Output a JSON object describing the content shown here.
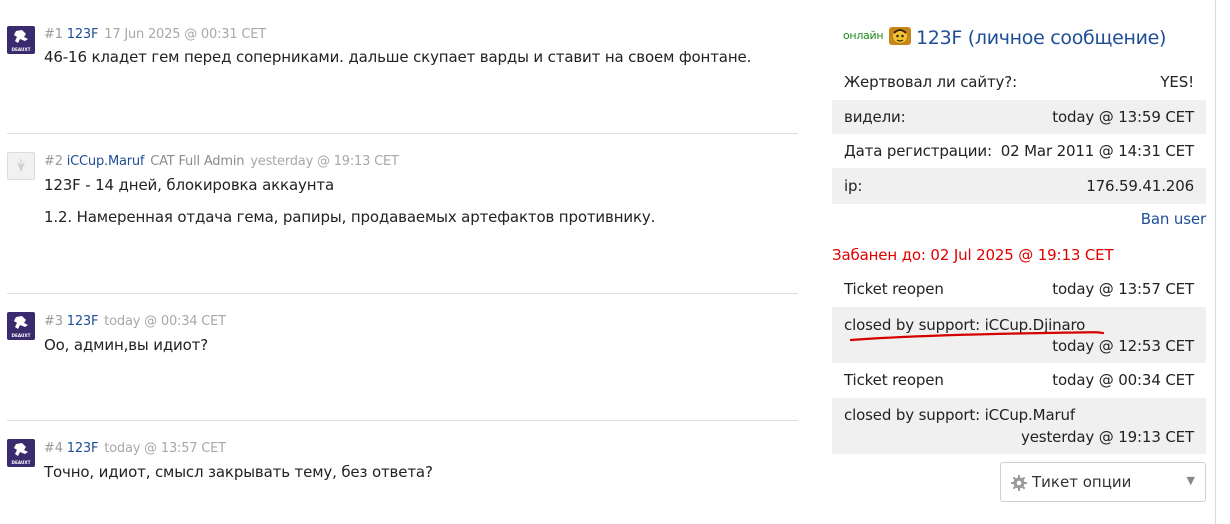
{
  "posts": [
    {
      "number": "#1",
      "user": "123F",
      "role": "",
      "time": "17 Jun 2025 @ 00:31 CET",
      "lines": [
        "46-16 кладет гем перед соперниками. дальше скупает варды и ставит на своем фонтане."
      ],
      "avatar": "team-logo"
    },
    {
      "number": "#2",
      "user": "iCCup.Maruf",
      "role": "CAT Full Admin",
      "time": "yesterday @ 19:13 CET",
      "lines": [
        "123F - 14 дней, блокировка аккаунта",
        "1.2. Намеренная отдача гема, рапиры, продаваемых артефактов противнику."
      ],
      "avatar": "default"
    },
    {
      "number": "#3",
      "user": "123F",
      "role": "",
      "time": "today @ 00:34 CET",
      "lines": [
        "Оо, админ,вы идиот?"
      ],
      "avatar": "team-logo"
    },
    {
      "number": "#4",
      "user": "123F",
      "role": "",
      "time": "today @ 13:57 CET",
      "lines": [
        "Точно, идиот, смысл закрывать тему, без ответа?"
      ],
      "avatar": "team-logo"
    }
  ],
  "avatar_logo_text": "DEAUXT",
  "profile": {
    "online_label": "онлайн",
    "name": "123F",
    "pm_label": "(личное сообщение)",
    "donated_label": "Жертвовал ли сайту?:",
    "donated_value": "YES!",
    "seen_label": "видели:",
    "seen_value": "today @ 13:59 CET",
    "registered_label": "Дата регистрации:",
    "registered_value": "02 Mar 2011 @ 14:31 CET",
    "ip_label": "ip:",
    "ip_value": "176.59.41.206",
    "ban_user_label": "Ban user",
    "banned_until": "Забанен до: 02 Jul 2025 @ 19:13 CET"
  },
  "history": [
    {
      "action": "Ticket reopen",
      "time": "today @ 13:57 CET"
    },
    {
      "action": "closed by support: iCCup.Djinaro",
      "time": "today @ 12:53 CET"
    },
    {
      "action": "Ticket reopen",
      "time": "today @ 00:34 CET"
    },
    {
      "action": "closed by support: iCCup.Maruf",
      "time": "yesterday @ 19:13 CET"
    }
  ],
  "ticket_options": {
    "selected": "Тикет опции",
    "icon": "gear-icon"
  },
  "colors": {
    "link": "#1f4e96",
    "ban_red": "#e00000",
    "online_green": "#1e8c1e",
    "annotation_red": "#d40000"
  }
}
